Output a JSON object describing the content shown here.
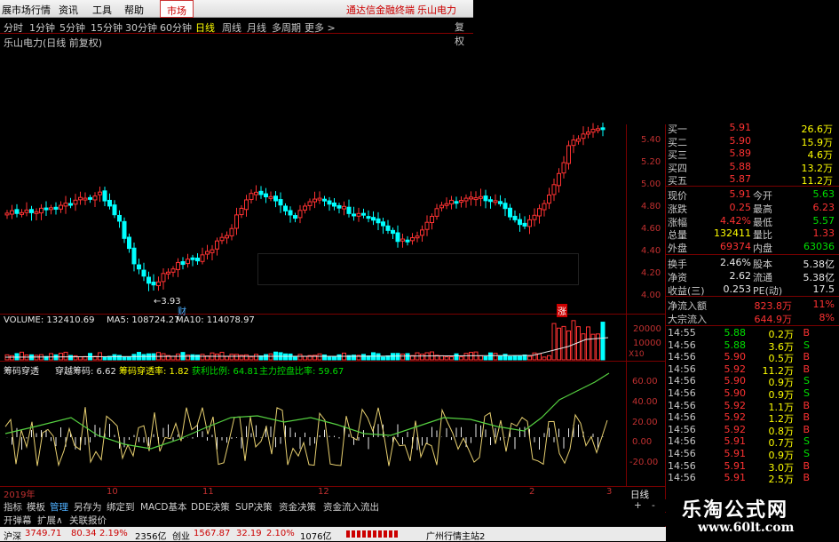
{
  "menu": {
    "items": [
      "展市场行情",
      "资讯",
      "工具",
      "帮助"
    ],
    "active": "市场",
    "promo": "通达信金融终端",
    "stock_name": "乐山电力"
  },
  "periods": [
    "分时",
    "1分钟",
    "5分钟",
    "15分钟",
    "30分钟",
    "60分钟",
    "日线",
    "周线",
    "月线",
    "多周期",
    "更多 >"
  ],
  "active_period": "日线",
  "fq_button": "复权",
  "chart_title": "乐山电力(日线 前复权)",
  "price_axis": [
    "5.40",
    "5.20",
    "5.00",
    "4.80",
    "4.60",
    "4.40",
    "4.20",
    "4.00"
  ],
  "low_marker": "3.93",
  "markers": {
    "cai": "财",
    "zhang": "涨"
  },
  "volume": {
    "label": "VOLUME: 132410.69",
    "ma5": "MA5: 108724.27",
    "ma10": "MA10: 114078.97",
    "axis": [
      "20000",
      "10000",
      "X10"
    ]
  },
  "indicator": {
    "name": "筹码穿透",
    "items": [
      {
        "text": "穿越筹码: 6.62",
        "color": "#e8e8e8"
      },
      {
        "text": "筹码穿透率: 1.82",
        "color": "#ffff00"
      },
      {
        "text": "获利比例: 64.81",
        "color": "#00e000"
      },
      {
        "text": "主力控盘比率: 59.67",
        "color": "#00e000"
      }
    ],
    "axis": [
      "60.00",
      "40.00",
      "20.00",
      "0.00",
      "-20.00"
    ]
  },
  "chart_data": {
    "type": "candlestick",
    "price_range": [
      3.9,
      5.5
    ],
    "low_point": 3.93,
    "indicator_range": [
      -30,
      70
    ]
  },
  "time_axis": [
    "2019年",
    "10",
    "11",
    "12",
    "2",
    "3"
  ],
  "bottom_tabs": [
    "指标",
    "模板",
    "管理",
    "另存为",
    "绑定到",
    "MACD基本",
    "DDE决策",
    "SUP决策",
    "资金决策",
    "资金流入流出"
  ],
  "bottom_tabs_active": "管理",
  "bottom_tabs2": [
    "开弹幕",
    "扩展∧",
    "关联报价"
  ],
  "period_label": "日线",
  "right_panel": {
    "bids": [
      {
        "label": "买一",
        "price": "5.91",
        "vol": "26.6万"
      },
      {
        "label": "买二",
        "price": "5.90",
        "vol": "15.9万"
      },
      {
        "label": "买三",
        "price": "5.89",
        "vol": "4.6万"
      },
      {
        "label": "买四",
        "price": "5.88",
        "vol": "13.2万"
      },
      {
        "label": "买五",
        "price": "5.87",
        "vol": "11.2万"
      }
    ],
    "stats": [
      {
        "l1": "现价",
        "v1": "5.91",
        "c1": "red",
        "l2": "今开",
        "v2": "5.63",
        "c2": "green"
      },
      {
        "l1": "涨跌",
        "v1": "0.25",
        "c1": "red",
        "l2": "最高",
        "v2": "6.23",
        "c2": "red"
      },
      {
        "l1": "涨幅",
        "v1": "4.42%",
        "c1": "red",
        "l2": "最低",
        "v2": "5.57",
        "c2": "green"
      },
      {
        "l1": "总量",
        "v1": "132411",
        "c1": "yellow",
        "l2": "量比",
        "v2": "1.33",
        "c2": "red"
      },
      {
        "l1": "外盘",
        "v1": "69374",
        "c1": "red",
        "l2": "内盘",
        "v2": "63036",
        "c2": "green"
      }
    ],
    "stats2": [
      {
        "l1": "换手",
        "v1": "2.46%",
        "c1": "white",
        "l2": "股本",
        "v2": "5.38亿",
        "c2": "white"
      },
      {
        "l1": "净资",
        "v1": "2.62",
        "c1": "white",
        "l2": "流通",
        "v2": "5.38亿",
        "c2": "white"
      },
      {
        "l1": "收益(三)",
        "v1": "0.253",
        "c1": "white",
        "l2": "PE(动)",
        "v2": "17.5",
        "c2": "white"
      }
    ],
    "flows": [
      {
        "label": "净流入额",
        "value": "823.8万",
        "pct": "11%"
      },
      {
        "label": "大宗流入",
        "value": "644.9万",
        "pct": "8%"
      }
    ],
    "ticks": [
      {
        "time": "14:55",
        "price": "5.88",
        "vol": "0.2万",
        "dir": "B"
      },
      {
        "time": "14:56",
        "price": "5.88",
        "vol": "3.6万",
        "dir": "S"
      },
      {
        "time": "14:56",
        "price": "5.90",
        "vol": "0.5万",
        "dir": "B"
      },
      {
        "time": "14:56",
        "price": "5.92",
        "vol": "11.2万",
        "dir": "B"
      },
      {
        "time": "14:56",
        "price": "5.90",
        "vol": "0.9万",
        "dir": "S"
      },
      {
        "time": "14:56",
        "price": "5.90",
        "vol": "0.9万",
        "dir": "S"
      },
      {
        "time": "14:56",
        "price": "5.92",
        "vol": "1.1万",
        "dir": "B"
      },
      {
        "time": "14:56",
        "price": "5.92",
        "vol": "1.2万",
        "dir": "B"
      },
      {
        "time": "14:56",
        "price": "5.92",
        "vol": "0.8万",
        "dir": "B"
      },
      {
        "time": "14:56",
        "price": "5.91",
        "vol": "0.7万",
        "dir": "S"
      },
      {
        "time": "14:56",
        "price": "5.91",
        "vol": "0.9万",
        "dir": "S"
      },
      {
        "time": "14:56",
        "price": "5.91",
        "vol": "3.0万",
        "dir": "B"
      },
      {
        "time": "14:56",
        "price": "5.91",
        "vol": "2.5万",
        "dir": "B"
      }
    ]
  },
  "status": {
    "hs_label": "沪深",
    "hs_value": "3749.71",
    "hs_chg": "80.34",
    "hs_pct": "2.19%",
    "hs_amt": "2356亿",
    "cy_label": "创业",
    "cy_value": "1567.87",
    "cy_chg": "32.19",
    "cy_pct": "2.10%",
    "cy_amt": "1076亿",
    "server": "广州行情主站2"
  },
  "watermark": {
    "title": "乐淘公式网",
    "url": "www.60lt.com"
  },
  "colors": {
    "up": "#ff3232",
    "down": "#00ffff",
    "grid": "#7a0000"
  }
}
